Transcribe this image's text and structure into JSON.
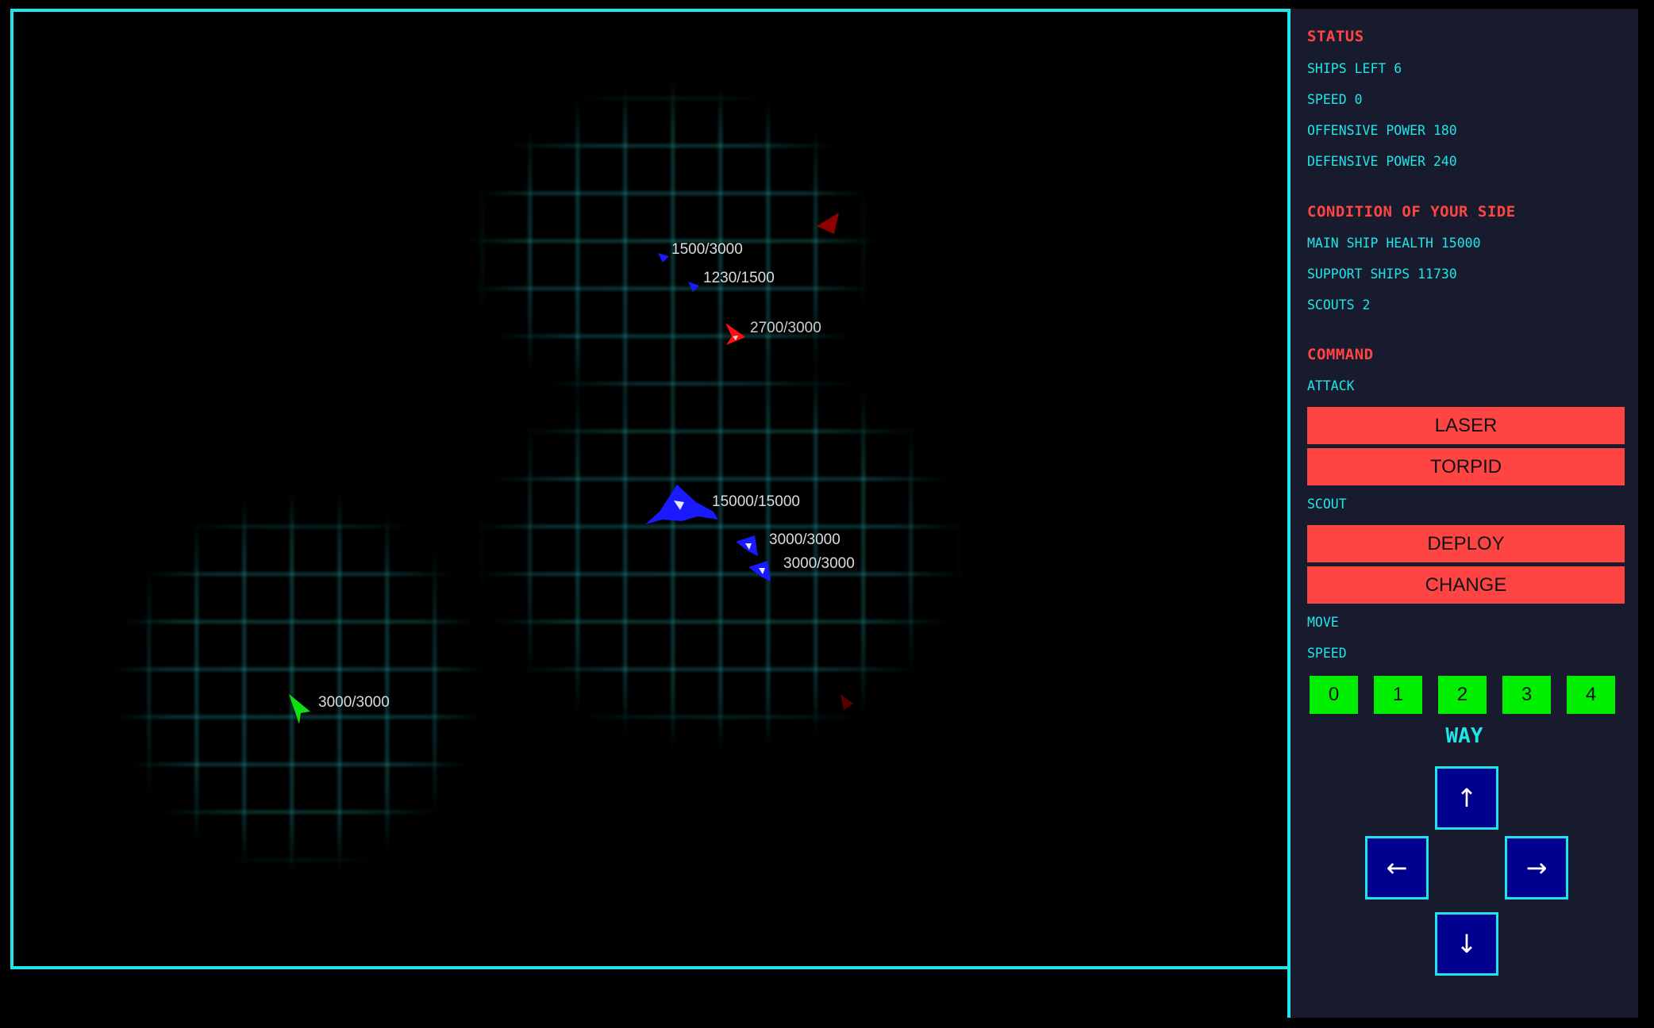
{
  "status": {
    "heading": "STATUS",
    "ships_left": "SHIPS LEFT 6",
    "speed": "SPEED 0",
    "offensive_power": "OFFENSIVE POWER 180",
    "defensive_power": "DEFENSIVE POWER 240"
  },
  "condition": {
    "heading": "CONDITION OF YOUR SIDE",
    "main_ship_health": "MAIN SHIP HEALTH 15000",
    "support_ships": "SUPPORT SHIPS 11730",
    "scouts": "SCOUTS 2"
  },
  "command": {
    "heading": "COMMAND",
    "attack_label": "ATTACK",
    "laser": "LASER",
    "torpid": "TORPID",
    "scout_label": "SCOUT",
    "deploy": "DEPLOY",
    "change": "CHANGE",
    "move_label": "MOVE",
    "speed_label": "SPEED",
    "speed_options": [
      "0",
      "1",
      "2",
      "3",
      "4"
    ],
    "way_label": "WAY",
    "arrows": {
      "up": "↑",
      "left": "←",
      "right": "→",
      "down": "↓"
    }
  },
  "units": [
    {
      "id": "blue-scout-1",
      "team": "blue",
      "kind": "scout",
      "hp": "1500/3000"
    },
    {
      "id": "blue-scout-2",
      "team": "blue",
      "kind": "scout",
      "hp": "1230/1500"
    },
    {
      "id": "red-ship-1",
      "team": "red",
      "kind": "support",
      "hp": "2700/3000"
    },
    {
      "id": "blue-main",
      "team": "blue",
      "kind": "main",
      "hp": "15000/15000"
    },
    {
      "id": "blue-support-1",
      "team": "blue",
      "kind": "support",
      "hp": "3000/3000"
    },
    {
      "id": "blue-support-2",
      "team": "blue",
      "kind": "support",
      "hp": "3000/3000"
    },
    {
      "id": "green-ship-1",
      "team": "green",
      "kind": "support",
      "hp": "3000/3000"
    }
  ],
  "colors": {
    "accent": "#1fe5e8",
    "alert": "#ff4543",
    "speed_button": "#00ee00",
    "direction_button": "#00008f",
    "panel_bg": "#181b2d",
    "blue_team": "#1a1aff",
    "red_team": "#ff1010",
    "green_team": "#10e010"
  }
}
